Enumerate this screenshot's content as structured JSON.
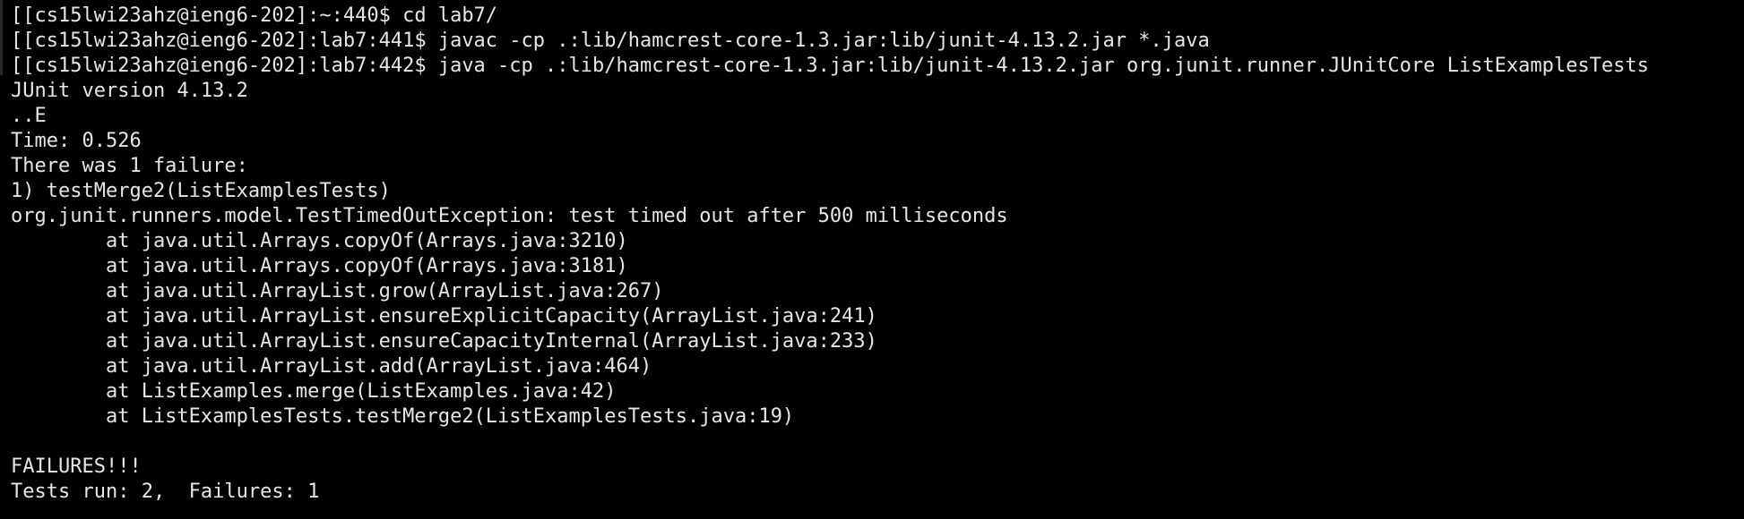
{
  "terminal": {
    "lines": [
      "[[cs15lwi23ahz@ieng6-202]:~:440$ cd lab7/",
      "[[cs15lwi23ahz@ieng6-202]:lab7:441$ javac -cp .:lib/hamcrest-core-1.3.jar:lib/junit-4.13.2.jar *.java",
      "[[cs15lwi23ahz@ieng6-202]:lab7:442$ java -cp .:lib/hamcrest-core-1.3.jar:lib/junit-4.13.2.jar org.junit.runner.JUnitCore ListExamplesTests",
      "JUnit version 4.13.2",
      "..E",
      "Time: 0.526",
      "There was 1 failure:",
      "1) testMerge2(ListExamplesTests)",
      "org.junit.runners.model.TestTimedOutException: test timed out after 500 milliseconds",
      "        at java.util.Arrays.copyOf(Arrays.java:3210)",
      "        at java.util.Arrays.copyOf(Arrays.java:3181)",
      "        at java.util.ArrayList.grow(ArrayList.java:267)",
      "        at java.util.ArrayList.ensureExplicitCapacity(ArrayList.java:241)",
      "        at java.util.ArrayList.ensureCapacityInternal(ArrayList.java:233)",
      "        at java.util.ArrayList.add(ArrayList.java:464)",
      "        at ListExamples.merge(ListExamples.java:42)",
      "        at ListExamplesTests.testMerge2(ListExamplesTests.java:19)",
      "",
      "FAILURES!!!",
      "Tests run: 2,  Failures: 1"
    ],
    "colors": {
      "background": "#000000",
      "foreground": "#e6e6e6"
    }
  }
}
